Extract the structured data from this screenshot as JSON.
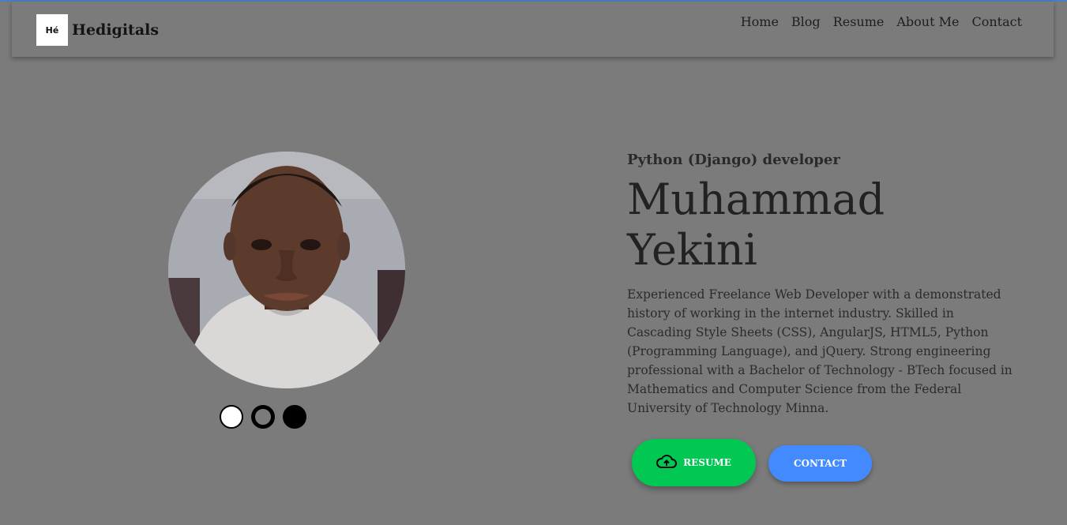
{
  "navbar": {
    "brand_logo_text": "Hé",
    "brand_name": "Hedigitals",
    "links": [
      "Home",
      "Blog",
      "Resume",
      "About Me",
      "Contact"
    ]
  },
  "hero": {
    "subtitle": "Python (Django) developer",
    "name_line1": "Muhammad",
    "name_line2": "Yekini",
    "bio": "Experienced Freelance Web Developer with a demonstrated history of working in the internet industry. Skilled in Cascading Style Sheets (CSS), AngularJS, HTML5, Python (Programming Language), and jQuery. Strong engineering professional with a Bachelor of Technology - BTech focused in Mathematics and Computer Science from the Federal University of Technology Minna.",
    "resume_label": "RESUME",
    "contact_label": "CONTACT"
  },
  "theme_dots": [
    "white",
    "outline",
    "black"
  ],
  "colors": {
    "background": "#7b7b7b",
    "resume_button": "#00c853",
    "contact_button": "#448aff",
    "top_accent": "#4a7fc1"
  },
  "icons": {
    "resume_icon": "cloud-upload-icon"
  }
}
